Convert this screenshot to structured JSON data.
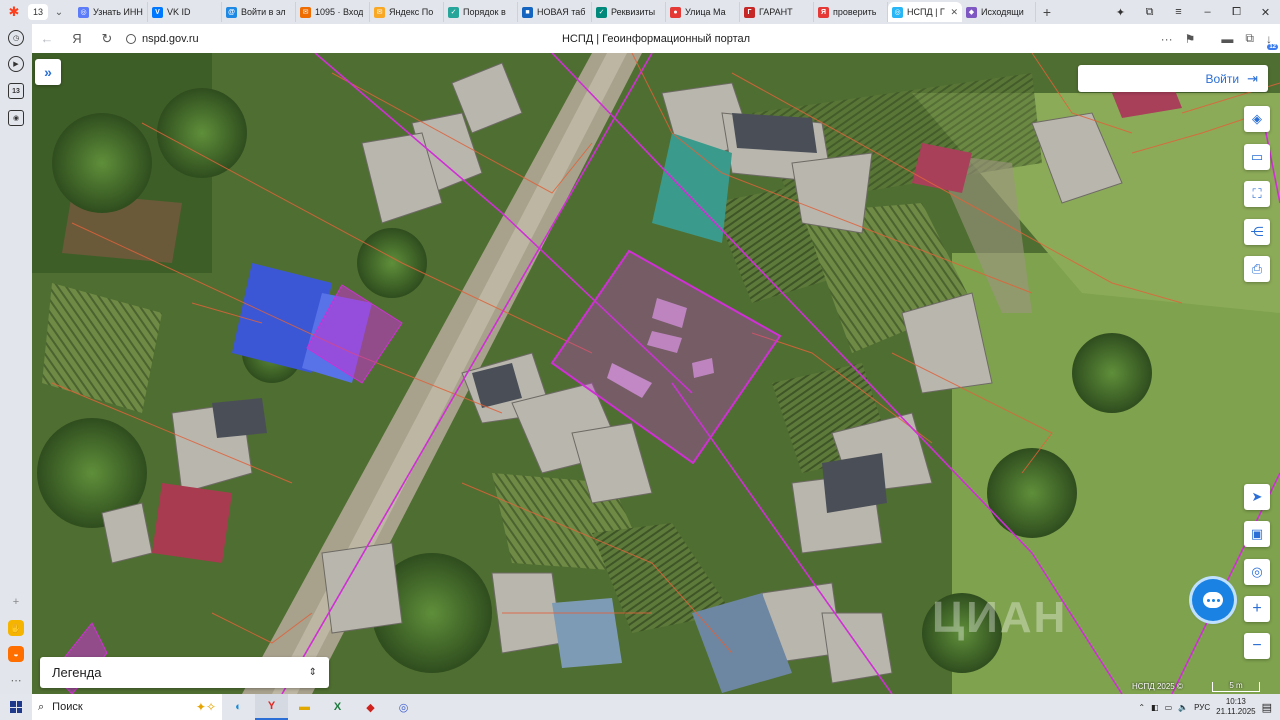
{
  "browser": {
    "tab_count": "13",
    "tabs": [
      {
        "label": "Узнать ИНН",
        "fav_color": "#5c7cfa",
        "fav_glyph": "◎"
      },
      {
        "label": "VK ID",
        "fav_color": "#0077ff",
        "fav_glyph": "V"
      },
      {
        "label": "Войти в эл",
        "fav_color": "#1e88e5",
        "fav_glyph": "@"
      },
      {
        "label": "1095 · Вход",
        "fav_color": "#ef6c00",
        "fav_glyph": "✉"
      },
      {
        "label": "Яндекс По",
        "fav_color": "#f9a825",
        "fav_glyph": "✉"
      },
      {
        "label": "Порядок в",
        "fav_color": "#26a69a",
        "fav_glyph": "✓"
      },
      {
        "label": "НОВАЯ таб",
        "fav_color": "#1565c0",
        "fav_glyph": "■"
      },
      {
        "label": "Реквизиты",
        "fav_color": "#00897b",
        "fav_glyph": "✓"
      },
      {
        "label": "Улица Ма",
        "fav_color": "#e53935",
        "fav_glyph": "●"
      },
      {
        "label": "ГАРАНТ",
        "fav_color": "#c62828",
        "fav_glyph": "Г"
      },
      {
        "label": "проверить",
        "fav_color": "#e53935",
        "fav_glyph": "Я"
      },
      {
        "label": "НСПД | Г",
        "fav_color": "#29b6f6",
        "fav_glyph": "◎",
        "active": true
      },
      {
        "label": "Исходящи",
        "fav_color": "#7e57c2",
        "fav_glyph": "◆"
      }
    ],
    "url": "nspd.gov.ru",
    "page_title": "НСПД | Геоинформационный портал",
    "downloads_badge": "12"
  },
  "map": {
    "login_label": "Войти",
    "legend_label": "Легенда",
    "copyright": "НСПД 2025 ©",
    "scale_label": "5 m",
    "watermark": "ЦИАН"
  },
  "taskbar": {
    "search_label": "Поиск",
    "language": "РУС",
    "time": "10:13",
    "date": "21.11.2025"
  }
}
